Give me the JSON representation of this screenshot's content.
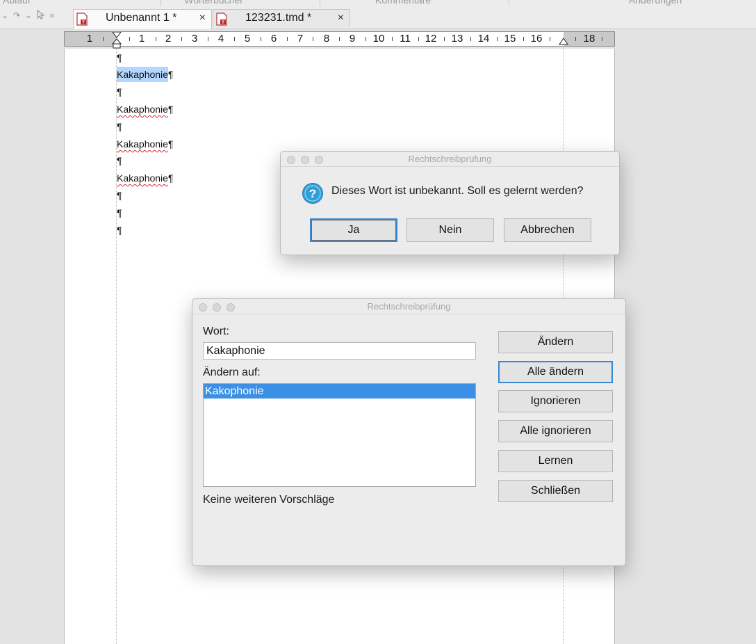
{
  "toolbar": {
    "cut_labels": [
      "Ablauf",
      "Wörterbücher",
      "Kommentare",
      "Änderungen"
    ]
  },
  "tabs": [
    {
      "label": "Unbenannt 1 *",
      "close": "×",
      "active": true
    },
    {
      "label": "123231.tmd *",
      "close": "×",
      "active": false
    }
  ],
  "ruler": {
    "numbers": [
      "1",
      "1",
      "2",
      "3",
      "4",
      "5",
      "6",
      "7",
      "8",
      "9",
      "10",
      "11",
      "12",
      "13",
      "14",
      "15",
      "16",
      "18"
    ]
  },
  "document": {
    "paragraphs": [
      {
        "text": "",
        "mark": "¶",
        "misspelled": false,
        "selected": false
      },
      {
        "text": "Kakaphonie",
        "mark": "¶",
        "misspelled": false,
        "selected": true
      },
      {
        "text": "",
        "mark": "¶",
        "misspelled": false,
        "selected": false
      },
      {
        "text": "Kakaphonie",
        "mark": "¶",
        "misspelled": true,
        "selected": false
      },
      {
        "text": "",
        "mark": "¶",
        "misspelled": false,
        "selected": false
      },
      {
        "text": "Kakaphonie",
        "mark": "¶",
        "misspelled": true,
        "selected": false
      },
      {
        "text": "",
        "mark": "¶",
        "misspelled": false,
        "selected": false
      },
      {
        "text": "Kakaphonie",
        "mark": "¶",
        "misspelled": true,
        "selected": false
      },
      {
        "text": "",
        "mark": "¶",
        "misspelled": false,
        "selected": false
      },
      {
        "text": "",
        "mark": "¶",
        "misspelled": false,
        "selected": false
      },
      {
        "text": "",
        "mark": "¶",
        "misspelled": false,
        "selected": false
      }
    ]
  },
  "confirm_dialog": {
    "title": "Rechtschreibprüfung",
    "message": "Dieses Wort ist unbekannt. Soll es gelernt werden?",
    "buttons": {
      "yes": "Ja",
      "no": "Nein",
      "cancel": "Abbrechen"
    }
  },
  "spell_dialog": {
    "title": "Rechtschreibprüfung",
    "word_label": "Wort:",
    "word_value": "Kakaphonie",
    "change_to_label": "Ändern auf:",
    "suggestions": [
      {
        "label": "Kakophonie",
        "selected": true
      }
    ],
    "status": "Keine weiteren Vorschläge",
    "buttons": {
      "change": "Ändern",
      "change_all": "Alle ändern",
      "ignore": "Ignorieren",
      "ignore_all": "Alle ignorieren",
      "learn": "Lernen",
      "close": "Schließen"
    }
  },
  "colors": {
    "selection": "#b4d5fe",
    "list_selection": "#3b8fe4",
    "focus_ring": "#3a87d4",
    "misspelling_underline": "#d8262c"
  }
}
